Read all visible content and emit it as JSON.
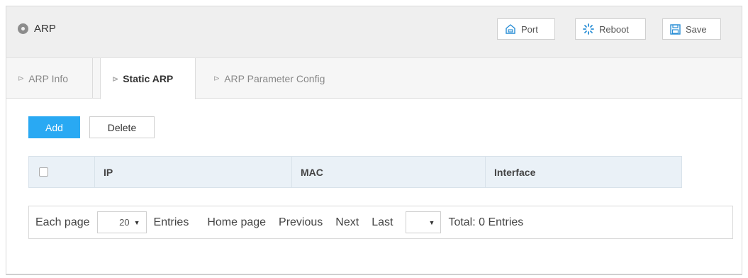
{
  "header": {
    "title": "ARP",
    "title_icon": "circle-icon",
    "buttons": {
      "port": "Port",
      "reboot": "Reboot",
      "save": "Save"
    }
  },
  "tabs": [
    {
      "label": "ARP Info",
      "active": false
    },
    {
      "label": "Static ARP",
      "active": true
    },
    {
      "label": "ARP Parameter Config",
      "active": false
    }
  ],
  "actions": {
    "add": "Add",
    "delete": "Delete"
  },
  "table": {
    "columns": [
      "IP",
      "MAC",
      "Interface"
    ],
    "rows": []
  },
  "pagination": {
    "each_page": "Each page",
    "page_size": "20",
    "entries": "Entries",
    "home": "Home page",
    "previous": "Previous",
    "next": "Next",
    "last": "Last",
    "page_select": "",
    "total": "Total: 0 Entries"
  },
  "colors": {
    "accent": "#29a9f3",
    "header_bg": "#efefef",
    "table_header_bg": "#eaf1f7"
  }
}
